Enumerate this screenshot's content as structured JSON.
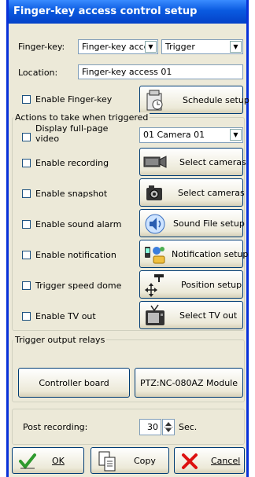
{
  "window": {
    "title": "Finger-key access control setup"
  },
  "top": {
    "fingerkey_label": "Finger-key:",
    "fingerkey_value": "Finger-key acces",
    "trigger_value": "Trigger",
    "location_label": "Location:",
    "location_value": "Finger-key access 01",
    "enable_fingerkey_label": "Enable Finger-key",
    "schedule_button": "Schedule setup"
  },
  "actions": {
    "group_title": "Actions to take when triggered",
    "rows": [
      {
        "label": "Display full-page video",
        "control": "01 Camera 01"
      },
      {
        "label": "Enable recording",
        "button": "Select cameras",
        "icon": "camera-icon"
      },
      {
        "label": "Enable snapshot",
        "button": "Select cameras",
        "icon": "snapshot-camera-icon"
      },
      {
        "label": "Enable sound alarm",
        "button": "Sound File setup",
        "icon": "speaker-icon"
      },
      {
        "label": "Enable notification",
        "button": "Notification setup",
        "icon": "notification-icon"
      },
      {
        "label": "Trigger speed dome",
        "button": "Position setup",
        "icon": "move-icon"
      },
      {
        "label": "Enable TV out",
        "button": "Select TV out",
        "icon": "tv-icon"
      }
    ]
  },
  "relays": {
    "group_title": "Trigger output relays",
    "controller_button": "Controller board",
    "module_button": "PTZ:NC-080AZ Module"
  },
  "post": {
    "label": "Post recording:",
    "value": "30",
    "unit": "Sec."
  },
  "footer": {
    "ok": "OK",
    "copy": "Copy",
    "cancel": "Cancel"
  },
  "colors": {
    "title_bar": "#0a5ae0",
    "window_border": "#0831d9",
    "face": "#ece9d8"
  }
}
